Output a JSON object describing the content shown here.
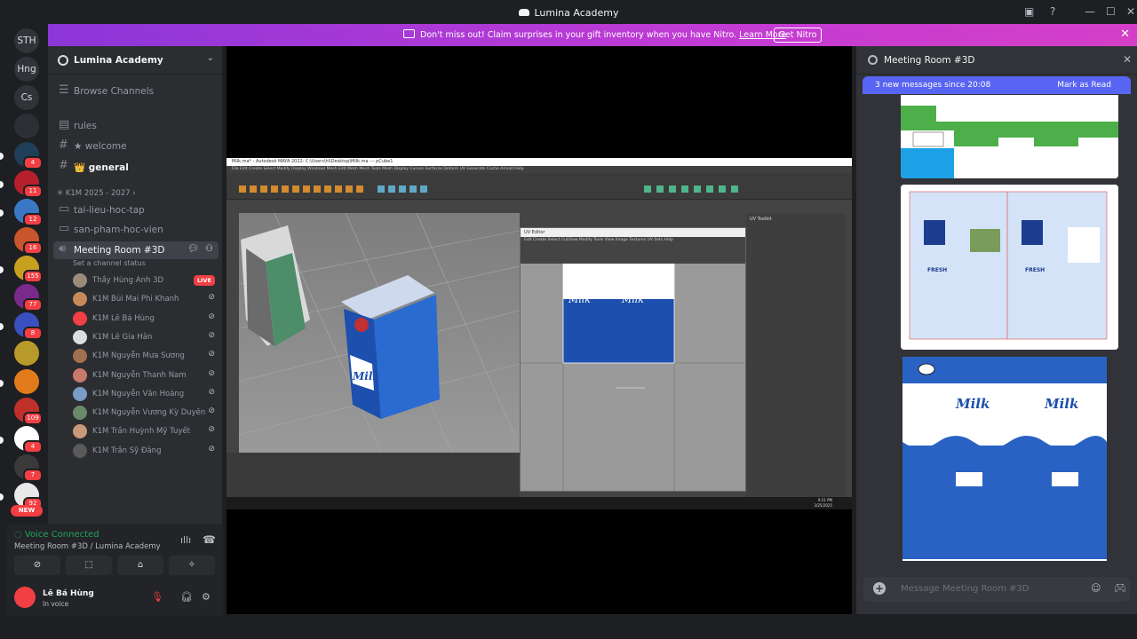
{
  "window": {
    "title": "Lumina Academy"
  },
  "banner": {
    "message": "Don't miss out! Claim surprises in your gift inventory when you have Nitro.",
    "link": "Learn More",
    "button": "Get Nitro"
  },
  "guilds": [
    {
      "label": "STH",
      "badge": ""
    },
    {
      "label": "Hng",
      "badge": ""
    },
    {
      "label": "Cs",
      "badge": ""
    },
    {
      "label": "",
      "badge": ""
    },
    {
      "label": "",
      "badge": "4"
    },
    {
      "label": "",
      "badge": "11"
    },
    {
      "label": "",
      "badge": "12"
    },
    {
      "label": "",
      "badge": "16"
    },
    {
      "label": "",
      "badge": "155"
    },
    {
      "label": "",
      "badge": "77"
    },
    {
      "label": "",
      "badge": "8"
    },
    {
      "label": "",
      "badge": ""
    },
    {
      "label": "",
      "badge": ""
    },
    {
      "label": "",
      "badge": "109"
    },
    {
      "label": "",
      "badge": "4"
    },
    {
      "label": "",
      "badge": "7"
    },
    {
      "label": "",
      "badge": "92"
    }
  ],
  "new_label": "NEW",
  "server": {
    "name": "Lumina Academy",
    "browse": "Browse Channels",
    "channels": {
      "rules": "rules",
      "welcome": "★ welcome",
      "general": "👑 general"
    },
    "category": "K1M 2025 - 2027",
    "k1m_channels": [
      "tai-lieu-hoc-tap",
      "san-pham-hoc-vien"
    ],
    "voice": {
      "name": "Meeting Room #3D",
      "status": "Set a channel status",
      "live": "LIVE",
      "members": [
        "Thầy Hùng Anh 3D",
        "K1M Bùi Mai Phi Khanh",
        "K1M Lê Bá Hùng",
        "K1M Lê Gia Hân",
        "K1M Nguyễn Mưa Sương",
        "K1M Nguyễn Thanh Nam",
        "K1M Nguyễn Văn Hoàng",
        "K1M Nguyễn Vương Kỳ Duyên",
        "K1M Trần Huỳnh Mỹ Tuyết",
        "K1M Trần Sỹ Đăng"
      ]
    }
  },
  "voice_panel": {
    "status": "Voice Connected",
    "location": "Meeting Room #3D / Lumina Academy"
  },
  "user": {
    "name": "Lê Bá Hùng",
    "status": "In voice"
  },
  "maya": {
    "title": "Milk.ma* - Autodesk MAYA 2022: C:\\Users\\hl\\Desktop\\Milk.ma --- pCube1",
    "menu": "File  Edit  Create  Select  Modify  Display  Windows  Mesh  Edit Mesh  Mesh Tools  Mesh Display  Curves  Surfaces  Deform  UV  Generate  Cache  Arnold  Help",
    "uv_title": "UV Editor",
    "uv_menu": "Edit  Create  Select  Cut/Sew  Modify  Tools  View  Image  Textures  UV Sets  Help",
    "toolkit": "UV Toolkit",
    "time": "9:21 PM",
    "date": "3/25/2025"
  },
  "thread": {
    "title": "Meeting Room #3D",
    "new_messages": "3 new messages since 20:08",
    "mark_read": "Mark as Read",
    "placeholder": "Message Meeting Room #3D"
  },
  "colors": {
    "accent": "#5865f2",
    "green": "#23a55a",
    "red": "#f23f43",
    "milk_blue": "#1c4fae"
  }
}
